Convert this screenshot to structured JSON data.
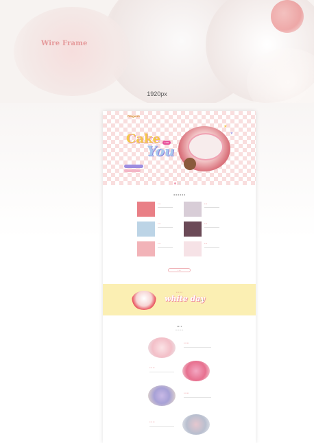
{
  "page": {
    "wire_title": "Wire Frame",
    "width_label": "1920px"
  },
  "hero": {
    "logo": "Dalgeun",
    "headline_cake": "Cake",
    "headline_for": "FOR",
    "headline_you": "You"
  },
  "white_day": {
    "label": "white day"
  },
  "colors": {
    "accent_pink": "#e59a9b",
    "checker_pink": "#f9dede",
    "banner_yellow": "#fbefb3",
    "text_red": "#e2575f"
  }
}
